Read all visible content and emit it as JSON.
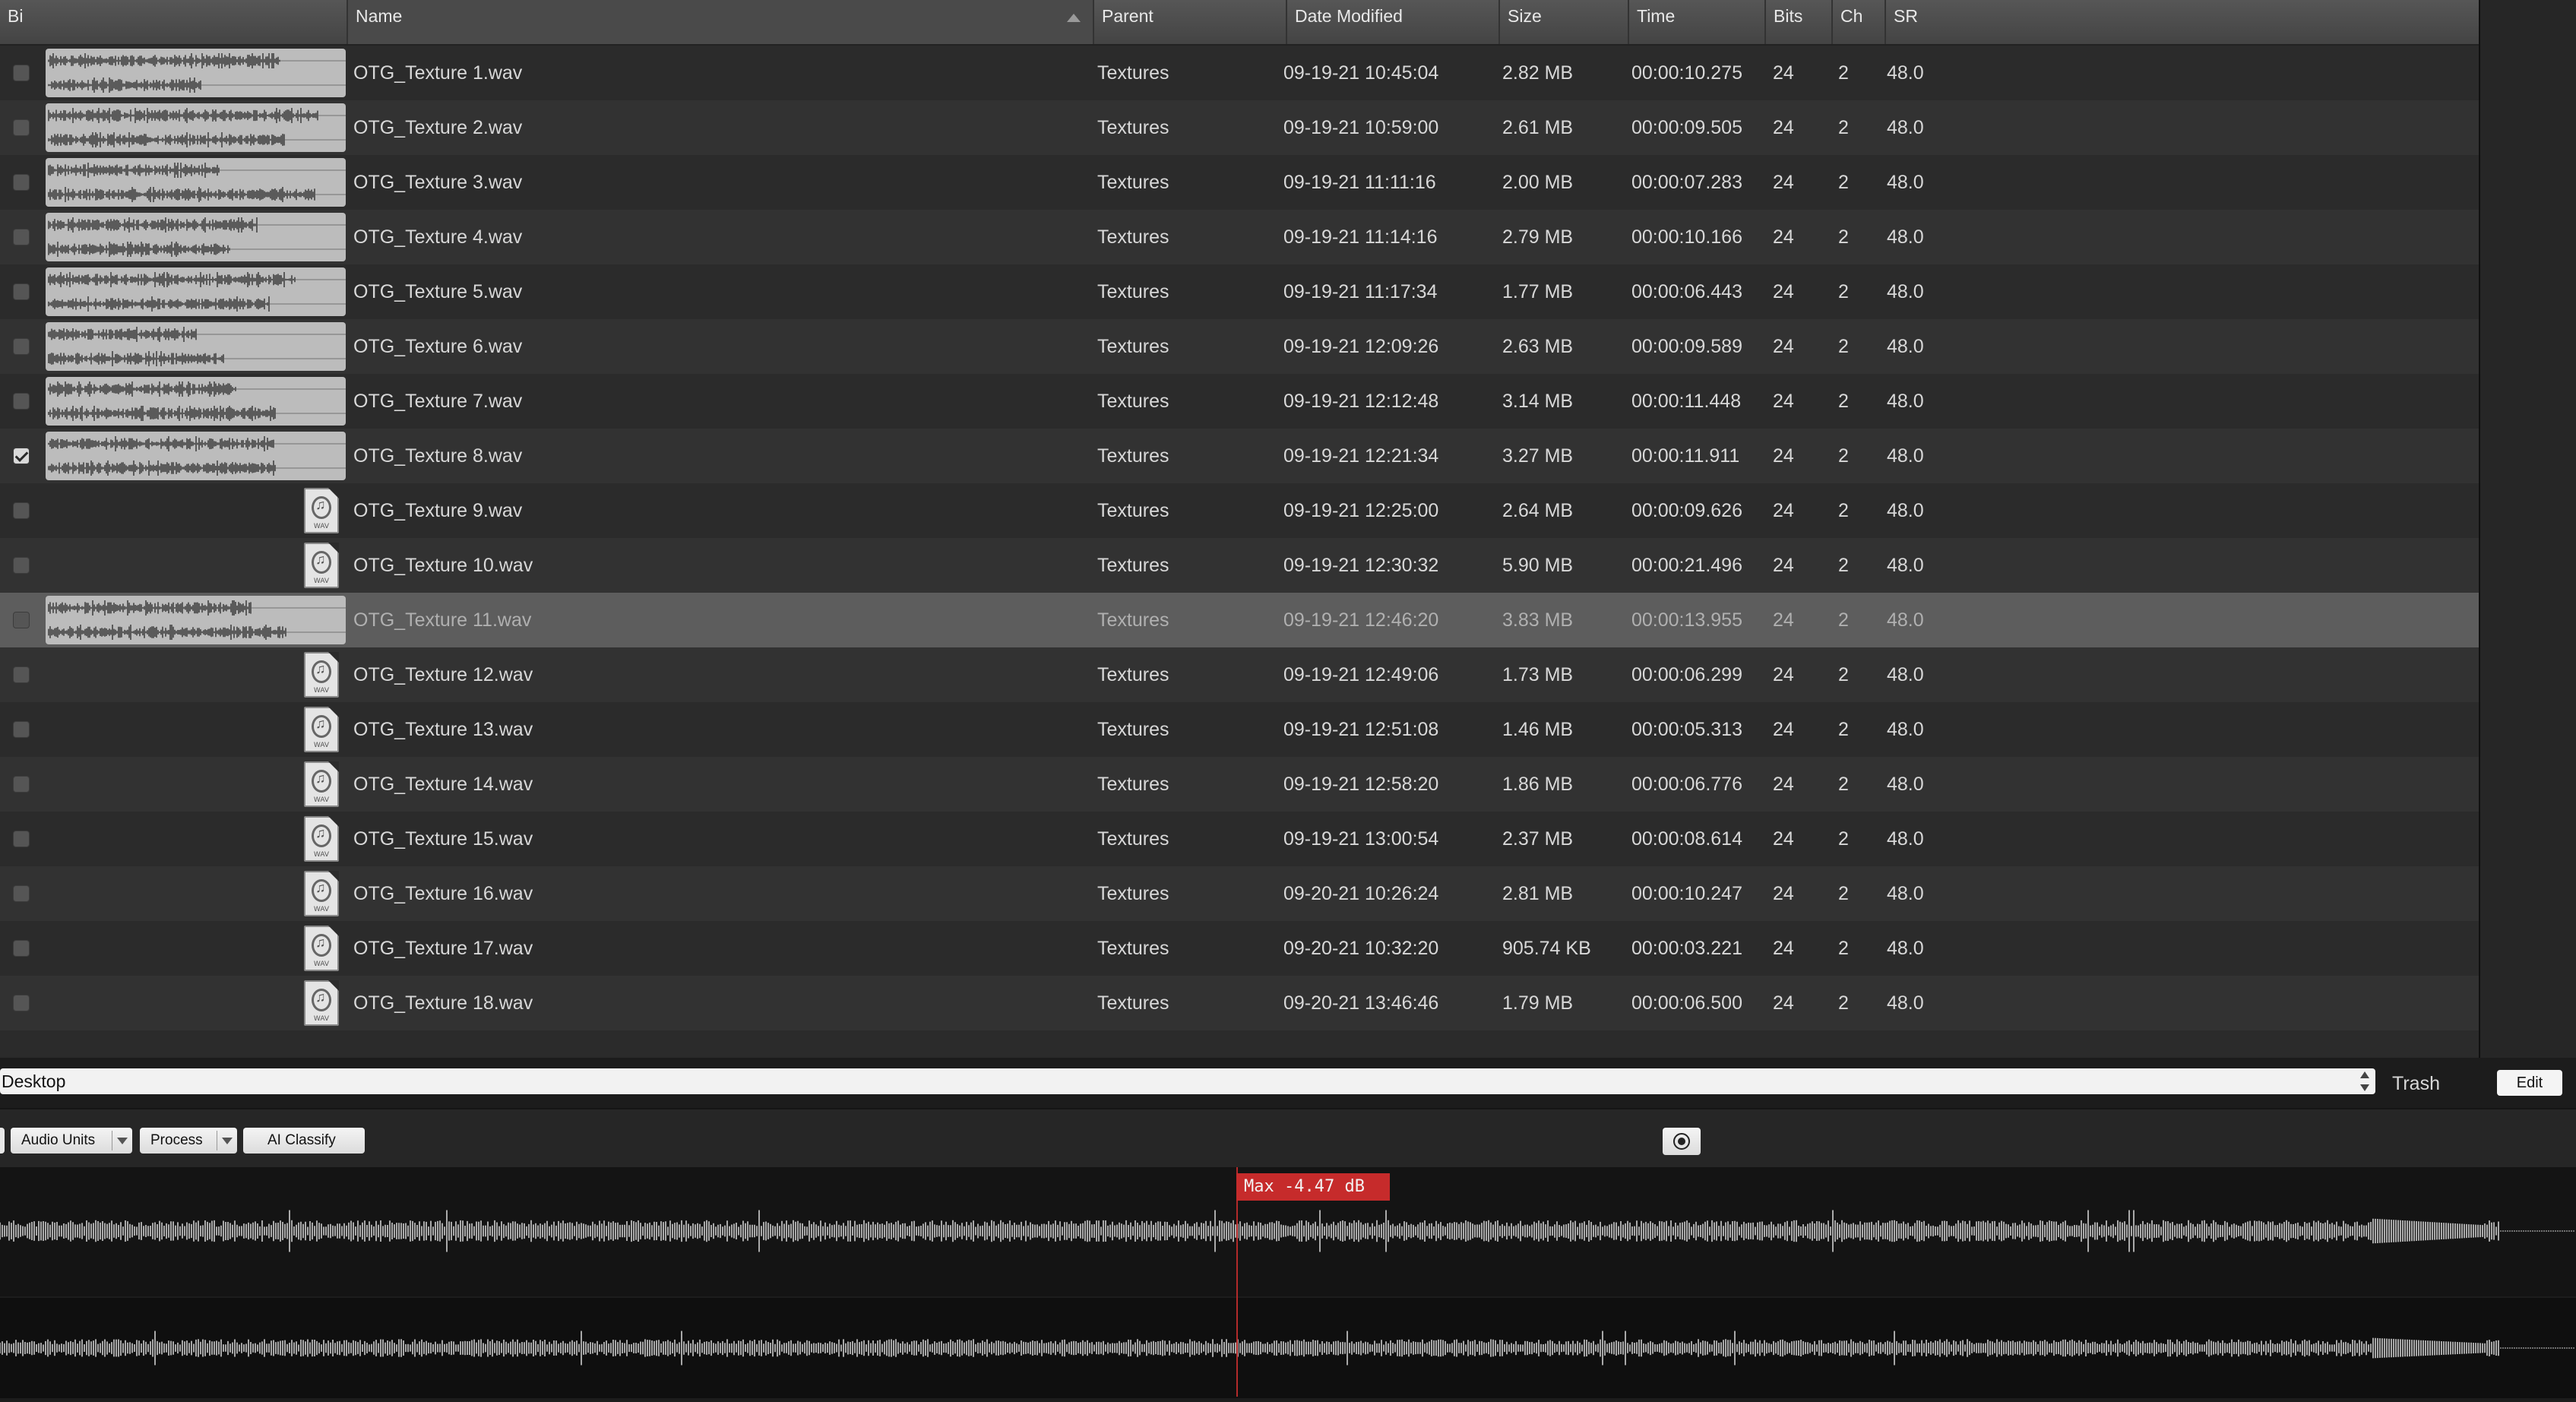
{
  "columns": {
    "bi": "Bi",
    "name": "Name",
    "parent": "Parent",
    "date_modified": "Date Modified",
    "size": "Size",
    "time": "Time",
    "bits": "Bits",
    "ch": "Ch",
    "sr": "SR"
  },
  "files": [
    {
      "name": "OTG_Texture 1.wav",
      "parent": "Textures",
      "date": "09-19-21 10:45:04",
      "size": "2.82 MB",
      "time": "00:00:10.275",
      "bits": "24",
      "ch": "2",
      "sr": "48.0",
      "checked": false,
      "waveform": true,
      "selected": false
    },
    {
      "name": "OTG_Texture 2.wav",
      "parent": "Textures",
      "date": "09-19-21 10:59:00",
      "size": "2.61 MB",
      "time": "00:00:09.505",
      "bits": "24",
      "ch": "2",
      "sr": "48.0",
      "checked": false,
      "waveform": true,
      "selected": false
    },
    {
      "name": "OTG_Texture 3.wav",
      "parent": "Textures",
      "date": "09-19-21 11:11:16",
      "size": "2.00 MB",
      "time": "00:00:07.283",
      "bits": "24",
      "ch": "2",
      "sr": "48.0",
      "checked": false,
      "waveform": true,
      "selected": false
    },
    {
      "name": "OTG_Texture 4.wav",
      "parent": "Textures",
      "date": "09-19-21 11:14:16",
      "size": "2.79 MB",
      "time": "00:00:10.166",
      "bits": "24",
      "ch": "2",
      "sr": "48.0",
      "checked": false,
      "waveform": true,
      "selected": false
    },
    {
      "name": "OTG_Texture 5.wav",
      "parent": "Textures",
      "date": "09-19-21 11:17:34",
      "size": "1.77 MB",
      "time": "00:00:06.443",
      "bits": "24",
      "ch": "2",
      "sr": "48.0",
      "checked": false,
      "waveform": true,
      "selected": false
    },
    {
      "name": "OTG_Texture 6.wav",
      "parent": "Textures",
      "date": "09-19-21 12:09:26",
      "size": "2.63 MB",
      "time": "00:00:09.589",
      "bits": "24",
      "ch": "2",
      "sr": "48.0",
      "checked": false,
      "waveform": true,
      "selected": false
    },
    {
      "name": "OTG_Texture 7.wav",
      "parent": "Textures",
      "date": "09-19-21 12:12:48",
      "size": "3.14 MB",
      "time": "00:00:11.448",
      "bits": "24",
      "ch": "2",
      "sr": "48.0",
      "checked": false,
      "waveform": true,
      "selected": false
    },
    {
      "name": "OTG_Texture 8.wav",
      "parent": "Textures",
      "date": "09-19-21 12:21:34",
      "size": "3.27 MB",
      "time": "00:00:11.911",
      "bits": "24",
      "ch": "2",
      "sr": "48.0",
      "checked": true,
      "waveform": true,
      "selected": false
    },
    {
      "name": "OTG_Texture 9.wav",
      "parent": "Textures",
      "date": "09-19-21 12:25:00",
      "size": "2.64 MB",
      "time": "00:00:09.626",
      "bits": "24",
      "ch": "2",
      "sr": "48.0",
      "checked": false,
      "waveform": false,
      "selected": false
    },
    {
      "name": "OTG_Texture 10.wav",
      "parent": "Textures",
      "date": "09-19-21 12:30:32",
      "size": "5.90 MB",
      "time": "00:00:21.496",
      "bits": "24",
      "ch": "2",
      "sr": "48.0",
      "checked": false,
      "waveform": false,
      "selected": false
    },
    {
      "name": "OTG_Texture 11.wav",
      "parent": "Textures",
      "date": "09-19-21 12:46:20",
      "size": "3.83 MB",
      "time": "00:00:13.955",
      "bits": "24",
      "ch": "2",
      "sr": "48.0",
      "checked": false,
      "waveform": true,
      "selected": true
    },
    {
      "name": "OTG_Texture 12.wav",
      "parent": "Textures",
      "date": "09-19-21 12:49:06",
      "size": "1.73 MB",
      "time": "00:00:06.299",
      "bits": "24",
      "ch": "2",
      "sr": "48.0",
      "checked": false,
      "waveform": false,
      "selected": false
    },
    {
      "name": "OTG_Texture 13.wav",
      "parent": "Textures",
      "date": "09-19-21 12:51:08",
      "size": "1.46 MB",
      "time": "00:00:05.313",
      "bits": "24",
      "ch": "2",
      "sr": "48.0",
      "checked": false,
      "waveform": false,
      "selected": false
    },
    {
      "name": "OTG_Texture 14.wav",
      "parent": "Textures",
      "date": "09-19-21 12:58:20",
      "size": "1.86 MB",
      "time": "00:00:06.776",
      "bits": "24",
      "ch": "2",
      "sr": "48.0",
      "checked": false,
      "waveform": false,
      "selected": false
    },
    {
      "name": "OTG_Texture 15.wav",
      "parent": "Textures",
      "date": "09-19-21 13:00:54",
      "size": "2.37 MB",
      "time": "00:00:08.614",
      "bits": "24",
      "ch": "2",
      "sr": "48.0",
      "checked": false,
      "waveform": false,
      "selected": false
    },
    {
      "name": "OTG_Texture 16.wav",
      "parent": "Textures",
      "date": "09-20-21 10:26:24",
      "size": "2.81 MB",
      "time": "00:00:10.247",
      "bits": "24",
      "ch": "2",
      "sr": "48.0",
      "checked": false,
      "waveform": false,
      "selected": false
    },
    {
      "name": "OTG_Texture 17.wav",
      "parent": "Textures",
      "date": "09-20-21 10:32:20",
      "size": "905.74 KB",
      "time": "00:00:03.221",
      "bits": "24",
      "ch": "2",
      "sr": "48.0",
      "checked": false,
      "waveform": false,
      "selected": false
    },
    {
      "name": "OTG_Texture 18.wav",
      "parent": "Textures",
      "date": "09-20-21 13:46:46",
      "size": "1.79 MB",
      "time": "00:00:06.500",
      "bits": "24",
      "ch": "2",
      "sr": "48.0",
      "checked": false,
      "waveform": false,
      "selected": false
    }
  ],
  "file_icon": {
    "icon": "wav-file-icon",
    "label": "WAV"
  },
  "path_bar": {
    "value": "Desktop"
  },
  "trash_label": "Trash",
  "edit_label": "Edit",
  "toolbar": {
    "audio_units": "Audio Units",
    "process": "Process",
    "ai_classify": "AI Classify",
    "target_icon": "target-icon"
  },
  "waveform": {
    "max_label": "Max -4.47 dB",
    "playhead_fraction": 0.48,
    "colors": {
      "playhead": "#b22a2a",
      "label_bg": "#c62b2b",
      "wave": "#cfcfcf"
    }
  }
}
